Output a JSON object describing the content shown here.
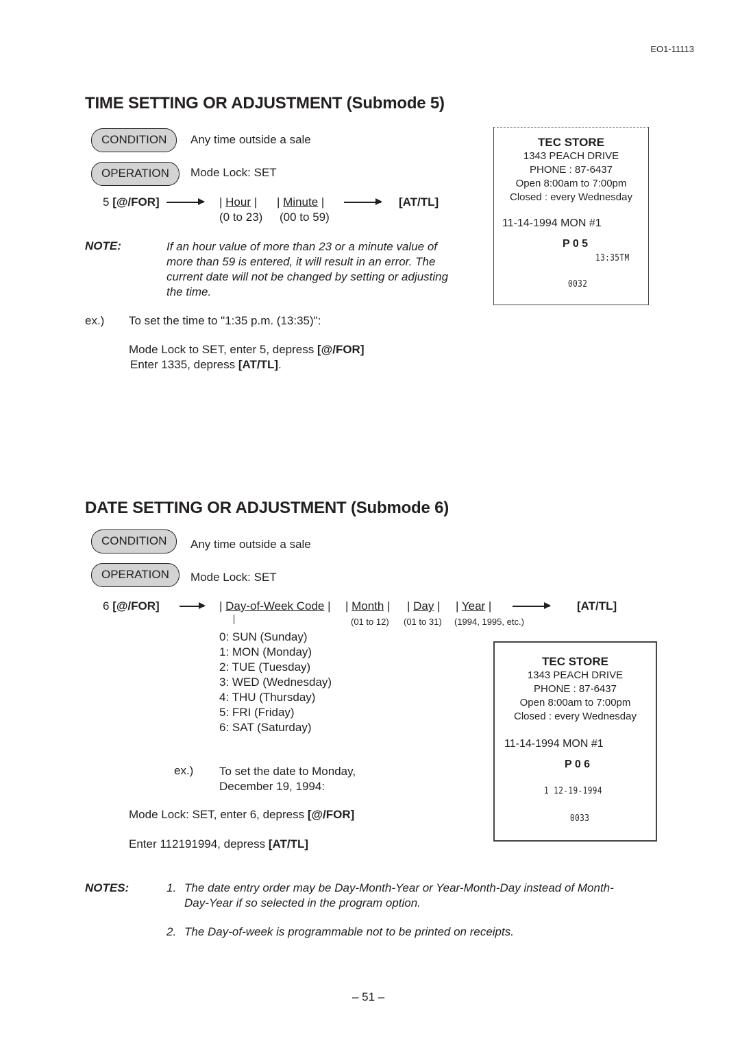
{
  "doc_id": "EO1-11113",
  "page_number": "– 51 –",
  "time_section": {
    "title": "TIME SETTING OR ADJUSTMENT (Submode 5)",
    "condition_label": "CONDITION",
    "condition_text": "Any time outside a sale",
    "operation_label": "OPERATION",
    "operation_text": "Mode Lock:  SET",
    "seq_prefix": "5 ",
    "seq_key": "[@/FOR]",
    "hour_field": "Hour",
    "hour_range": "(0 to 23)",
    "minute_field": "Minute",
    "minute_range": "(00 to 59)",
    "end_key": "[AT/TL]",
    "note_label": "NOTE:",
    "note_lines": [
      "If an hour value of more than 23 or a minute value of",
      "more than 59 is entered, it will result in an error.  The",
      "current date will not be changed by setting or adjusting",
      "the time."
    ],
    "example_label": "ex.)",
    "example_text": "To set the time to \"1:35 p.m. (13:35)\":",
    "step1_text": "Mode Lock to SET, enter 5, depress ",
    "step1_key": "[@/FOR]",
    "step2_text": "Enter 1335, depress ",
    "step2_key": "[AT/TL]",
    "step2_end": ".",
    "receipt": {
      "store": "TEC STORE",
      "address": "1343 PEACH DRIVE",
      "phone": "PHONE : 87-6437",
      "hours": "Open 8:00am to 7:00pm",
      "closed": "Closed : every Wednesday",
      "date_line": "11-14-1994  MON  #1",
      "code": "P 0 5",
      "value": "13:35TM",
      "counter": "0032"
    }
  },
  "date_section": {
    "title": "DATE SETTING OR ADJUSTMENT (Submode 6)",
    "condition_label": "CONDITION",
    "condition_text": "Any time outside a sale",
    "operation_label": "OPERATION",
    "operation_text": "Mode Lock: SET",
    "seq_prefix": "6 ",
    "seq_key": "[@/FOR]",
    "dow_field": "Day-of-Week Code",
    "month_field": "Month",
    "month_range": "(01 to 12)",
    "day_field": "Day",
    "day_range": "(01 to 31)",
    "year_field": "Year",
    "year_range": "(1994, 1995, etc.)",
    "end_key": "[AT/TL]",
    "dow_codes": [
      "0: SUN (Sunday)",
      "1: MON (Monday)",
      "2: TUE (Tuesday)",
      "3: WED (Wednesday)",
      "4: THU (Thursday)",
      "5: FRI (Friday)",
      "6: SAT (Saturday)"
    ],
    "example_label": "ex.)",
    "example_line1": "To set the date to Monday,",
    "example_line2": "December 19, 1994:",
    "step1_text": "Mode Lock: SET, enter 6, depress ",
    "step1_key": "[@/FOR]",
    "step2_text": "Enter 112191994, depress ",
    "step2_key": "[AT/TL]",
    "receipt": {
      "store": "TEC STORE",
      "address": "1343 PEACH DRIVE",
      "phone": "PHONE : 87-6437",
      "hours": "Open 8:00am to 7:00pm",
      "closed": "Closed : every Wednesday",
      "date_line": "11-14-1994  MON  #1",
      "code": "P 0 6",
      "value": "1 12-19-1994",
      "counter": "0033"
    }
  },
  "notes": {
    "label": "NOTES:",
    "items": [
      {
        "num": "1.",
        "line1": "The date entry order may be Day-Month-Year or Year-Month-Day instead of Month-",
        "line2": "Day-Year if so selected in the program option."
      },
      {
        "num": "2.",
        "line1": "The Day-of-week is programmable not to be printed on receipts."
      }
    ]
  }
}
